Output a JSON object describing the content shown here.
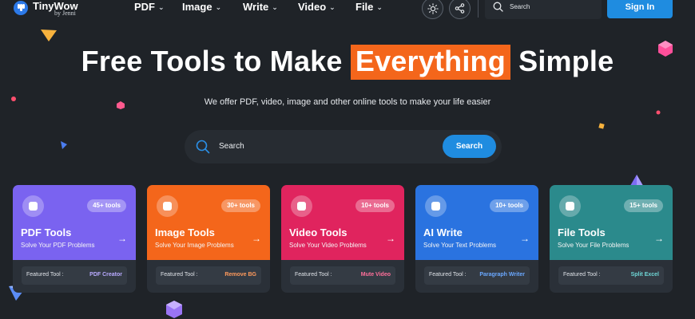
{
  "header": {
    "logo_name": "TinyWow",
    "logo_sub": "by Jenni",
    "nav": [
      {
        "label": "PDF"
      },
      {
        "label": "Image"
      },
      {
        "label": "Write"
      },
      {
        "label": "Video"
      },
      {
        "label": "File"
      }
    ],
    "search_placeholder": "Search",
    "signin_label": "Sign In"
  },
  "hero": {
    "title_before": "Free Tools to Make",
    "title_highlight": "Everything",
    "title_after": "Simple",
    "subtitle": "We offer PDF, video, image and other online tools to make your life easier",
    "search_placeholder": "Search",
    "search_button": "Search"
  },
  "featured_label": "Featured Tool :",
  "cards": [
    {
      "title": "PDF Tools",
      "desc": "Solve Your PDF Problems",
      "badge": "45+ tools",
      "featured": "PDF Creator",
      "color": "#7a63f0",
      "accent": "#b9aaff"
    },
    {
      "title": "Image Tools",
      "desc": "Solve Your Image Problems",
      "badge": "30+ tools",
      "featured": "Remove BG",
      "color": "#f4661b",
      "accent": "#ff9a5c"
    },
    {
      "title": "Video Tools",
      "desc": "Solve Your Video Problems",
      "badge": "10+ tools",
      "featured": "Mute Video",
      "color": "#e0245e",
      "accent": "#ff6f9a"
    },
    {
      "title": "AI Write",
      "desc": "Solve Your Text Problems",
      "badge": "10+ tools",
      "featured": "Paragraph Writer",
      "color": "#2a73e0",
      "accent": "#6aa8ff"
    },
    {
      "title": "File Tools",
      "desc": "Solve Your File Problems",
      "badge": "15+ tools",
      "featured": "Split Excel",
      "color": "#2b8a8c",
      "accent": "#6fd6d6"
    }
  ]
}
